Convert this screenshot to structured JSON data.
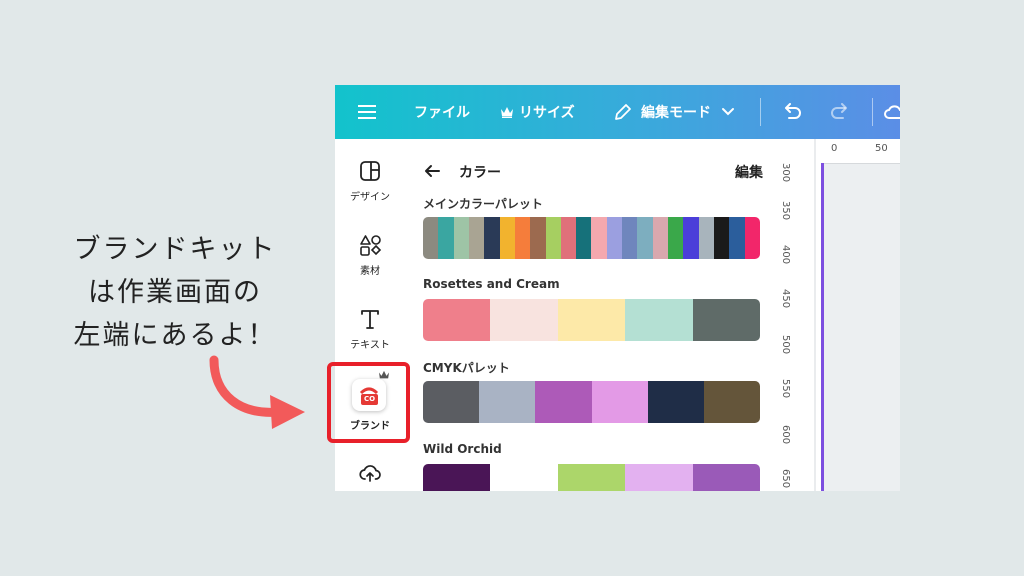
{
  "annotation": {
    "lines": [
      "ブランドキット",
      "は作業画面の",
      "左端にあるよ！"
    ],
    "arrow_color": "#f25a5a"
  },
  "topbar": {
    "menu_icon": "hamburger-icon",
    "file": "ファイル",
    "resize": "リサイズ",
    "edit_mode": "編集モード",
    "gradient": [
      "#12c3cc",
      "#5b8ee6"
    ]
  },
  "rail": {
    "items": [
      {
        "label": "デザイン",
        "icon": "design-layout-icon"
      },
      {
        "label": "素材",
        "icon": "elements-shapes-icon"
      },
      {
        "label": "テキスト",
        "icon": "text-icon"
      },
      {
        "label": "ブランド",
        "icon": "brand-kit-icon",
        "badge": "CO"
      },
      {
        "label": "",
        "icon": "cloud-upload-icon"
      }
    ],
    "highlight_color": "#e8202a"
  },
  "panel": {
    "title": "カラー",
    "edit": "編集",
    "palettes": [
      {
        "name": "メインカラーパレット",
        "colors": [
          "#8c8a80",
          "#3aa6a1",
          "#9ec4a6",
          "#a9a493",
          "#2a3a57",
          "#f2b32e",
          "#f57d3b",
          "#9c6a4f",
          "#a6cf61",
          "#e0707a",
          "#16717a",
          "#f4a8ae",
          "#9b9fe0",
          "#6f86bd",
          "#7daebf",
          "#d9a8ae",
          "#3aa84a",
          "#4b3ed9",
          "#a8b4bc",
          "#1a1a1a",
          "#2b5e9c",
          "#f2266a"
        ]
      },
      {
        "name": "Rosettes and Cream",
        "colors": [
          "#ef7f8b",
          "#f8e3df",
          "#fde9a8",
          "#b4e0d3",
          "#5f6b68"
        ]
      },
      {
        "name": "CMYKパレット",
        "colors": [
          "#5b5d62",
          "#a9b3c4",
          "#ad5ab8",
          "#e39ae6",
          "#1f2d47",
          "#64553a"
        ]
      },
      {
        "name": "Wild Orchid",
        "colors": [
          "#4a1556",
          "#ffffff",
          "#acd66a",
          "#e3b1f0",
          "#9a5ab8"
        ]
      }
    ]
  },
  "ruler": {
    "vertical": [
      "300",
      "350",
      "400",
      "450",
      "500",
      "550",
      "600",
      "650"
    ],
    "horizontal": [
      "0",
      "50"
    ],
    "guide_color": "#7d4fe0"
  }
}
